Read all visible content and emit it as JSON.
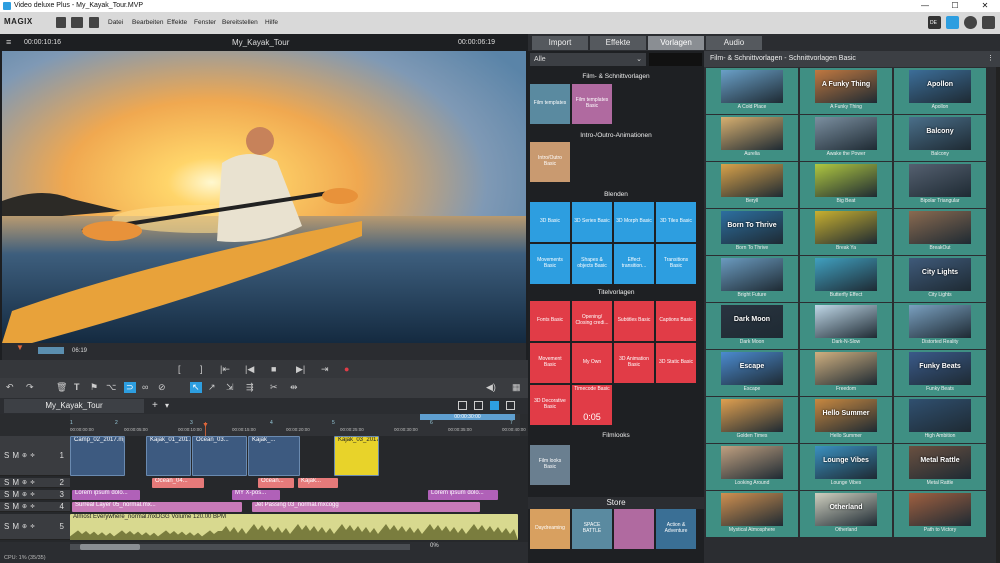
{
  "window": {
    "title": "Video deluxe Plus - My_Kayak_Tour.MVP",
    "min": "—",
    "max": "☐",
    "close": "✕"
  },
  "menu": {
    "logo": "MAGIX",
    "items": [
      "Datei",
      "Bearbeiten",
      "Effekte",
      "Fenster",
      "Bereitstellen",
      "Hilfe"
    ],
    "right_label": "DE"
  },
  "player": {
    "timecode_left": "00:00:10:16",
    "title": "My_Kayak_Tour",
    "timecode_right": "00:00:06:19",
    "seek_time": "06:19",
    "progress": 0.17
  },
  "transport": {
    "in": "[",
    "out": "]",
    "prev": "|⇤",
    "back": "|◀",
    "stop": "■",
    "play": "▶",
    "fwd": "▶|",
    "next": "⇥",
    "record": "●"
  },
  "timeline": {
    "tab": "My_Kayak_Tour",
    "add": "+",
    "dropdown": "▾",
    "ruler": [
      "00:00:00:00",
      "00:00:05:00",
      "00:00:10:00",
      "00:00:15:00",
      "00:00:20:00",
      "00:00:25:00",
      "00:00:30:00",
      "00:00:35:00",
      "00:00:40:00"
    ],
    "ruler_marks": [
      "1",
      "2",
      "3",
      "4",
      "5",
      "6",
      "7"
    ],
    "ruler_highlight": "00:00:30:00",
    "track_numbers": [
      "1",
      "2",
      "3",
      "4",
      "5"
    ],
    "clips": {
      "t1": [
        {
          "label": "Camp_02_2017.mp4",
          "color": "#3d5a80"
        },
        {
          "label": "Kajak_01_201...",
          "color": "#3d5a80"
        },
        {
          "label": "Ocean_03...",
          "color": "#3d5a80"
        },
        {
          "label": "Kajak_...",
          "color": "#3d5a80"
        },
        {
          "label": "Kajak_03_2017.mp4",
          "color": "#e8d32a"
        }
      ],
      "t2": [
        {
          "label": "Ocean_04...",
          "color": "#e67a7a"
        },
        {
          "label": "Ocean...",
          "color": "#e67a7a"
        },
        {
          "label": "Kajak...",
          "color": "#e67a7a"
        }
      ],
      "t3": [
        {
          "label": "Lorem ipsum dolo...",
          "color": "#b061b8"
        },
        {
          "label": "MY X-pos...",
          "color": "#b061b8"
        },
        {
          "label": "Lorem ipsum dolo...",
          "color": "#b061b8"
        }
      ],
      "t4": [
        {
          "label": "Surreal Layer 05_normal.mx...",
          "color": "#c77ab8"
        },
        {
          "label": "Jet Passing 03_normal.mxcogg",
          "color": "#c77ab8"
        }
      ],
      "t5": [
        {
          "label": "Almost Everywhere_normal.mxDGG   Volume  120.00 BPM",
          "color": "#d8d98f"
        }
      ]
    },
    "zoom": "0%",
    "status": "CPU: 1% (35/35)"
  },
  "panel": {
    "tabs": [
      "Import",
      "Effekte",
      "Vorlagen",
      "Audio"
    ],
    "active_tab": "Vorlagen",
    "filter": "Alle",
    "sections": [
      {
        "title": "Film- & Schnittvorlagen",
        "tiles": [
          "Film templates",
          "Film templates Basic"
        ]
      },
      {
        "title": "Intro-/Outro-Animationen",
        "tiles": [
          "Intro/Outro Basic"
        ]
      },
      {
        "title": "Blenden",
        "tiles": [
          "3D Basic",
          "3D Series Basic",
          "3D Morph Basic",
          "3D Tiles Basic",
          "Movements Basic",
          "Shapes & objects Basic",
          "Effect transition...",
          "Transitions Basic"
        ]
      },
      {
        "title": "Titelvorlagen",
        "tiles": [
          "Fonts Basic",
          "Opening/ Closing credi...",
          "Subtitles Basic",
          "Captions Basic",
          "Movement Basic",
          "My Own",
          "3D Animation Basic",
          "3D Static Basic",
          "3D Decorative Basic",
          "Timecode Basic"
        ]
      },
      {
        "title": "Filmlooks",
        "tiles": [
          "Film looks Basic"
        ]
      },
      {
        "title": "Store",
        "tiles": [
          "Daydreaming",
          "SPACE BATTLE",
          "",
          "Action & Adventure"
        ]
      }
    ],
    "timecode_tile_text": "0:05",
    "grid_title": "Film- & Schnittvorlagen - Schnittvorlagen Basic",
    "templates": [
      {
        "name": "A Cold Place",
        "overlay": ""
      },
      {
        "name": "A Funky Thing",
        "overlay": "A Funky Thing"
      },
      {
        "name": "Apollon",
        "overlay": "Apollon"
      },
      {
        "name": "Aurelia",
        "overlay": ""
      },
      {
        "name": "Awake the Power",
        "overlay": ""
      },
      {
        "name": "Balcony",
        "overlay": "Balcony"
      },
      {
        "name": "Beryll",
        "overlay": ""
      },
      {
        "name": "Big Beat",
        "overlay": ""
      },
      {
        "name": "Bipolar Triangular",
        "overlay": ""
      },
      {
        "name": "Born To Thrive",
        "overlay": "Born To Thrive"
      },
      {
        "name": "Break Ya",
        "overlay": ""
      },
      {
        "name": "BreakOut",
        "overlay": ""
      },
      {
        "name": "Bright Future",
        "overlay": ""
      },
      {
        "name": "Butterfly Effect",
        "overlay": ""
      },
      {
        "name": "City Lights",
        "overlay": "City Lights"
      },
      {
        "name": "Dark Moon",
        "overlay": "Dark Moon"
      },
      {
        "name": "Dark-N-Slow",
        "overlay": ""
      },
      {
        "name": "Distorted Reality",
        "overlay": ""
      },
      {
        "name": "Escape",
        "overlay": "Escape"
      },
      {
        "name": "Freedom",
        "overlay": ""
      },
      {
        "name": "Funky Beats",
        "overlay": "Funky Beats"
      },
      {
        "name": "Golden Times",
        "overlay": ""
      },
      {
        "name": "Hello Summer",
        "overlay": "Hello Summer"
      },
      {
        "name": "High Ambition",
        "overlay": ""
      },
      {
        "name": "Looking Around",
        "overlay": ""
      },
      {
        "name": "Lounge Vibes",
        "overlay": "Lounge Vibes"
      },
      {
        "name": "Metal Rattle",
        "overlay": "Metal Rattle"
      },
      {
        "name": "Mystical Atmosphere",
        "overlay": ""
      },
      {
        "name": "Otherland",
        "overlay": "Otherland"
      },
      {
        "name": "Path to Victory",
        "overlay": ""
      }
    ]
  },
  "colors": {
    "accent": "#e13c47",
    "blue": "#2d9ee0",
    "grid": "#3f8f83"
  }
}
